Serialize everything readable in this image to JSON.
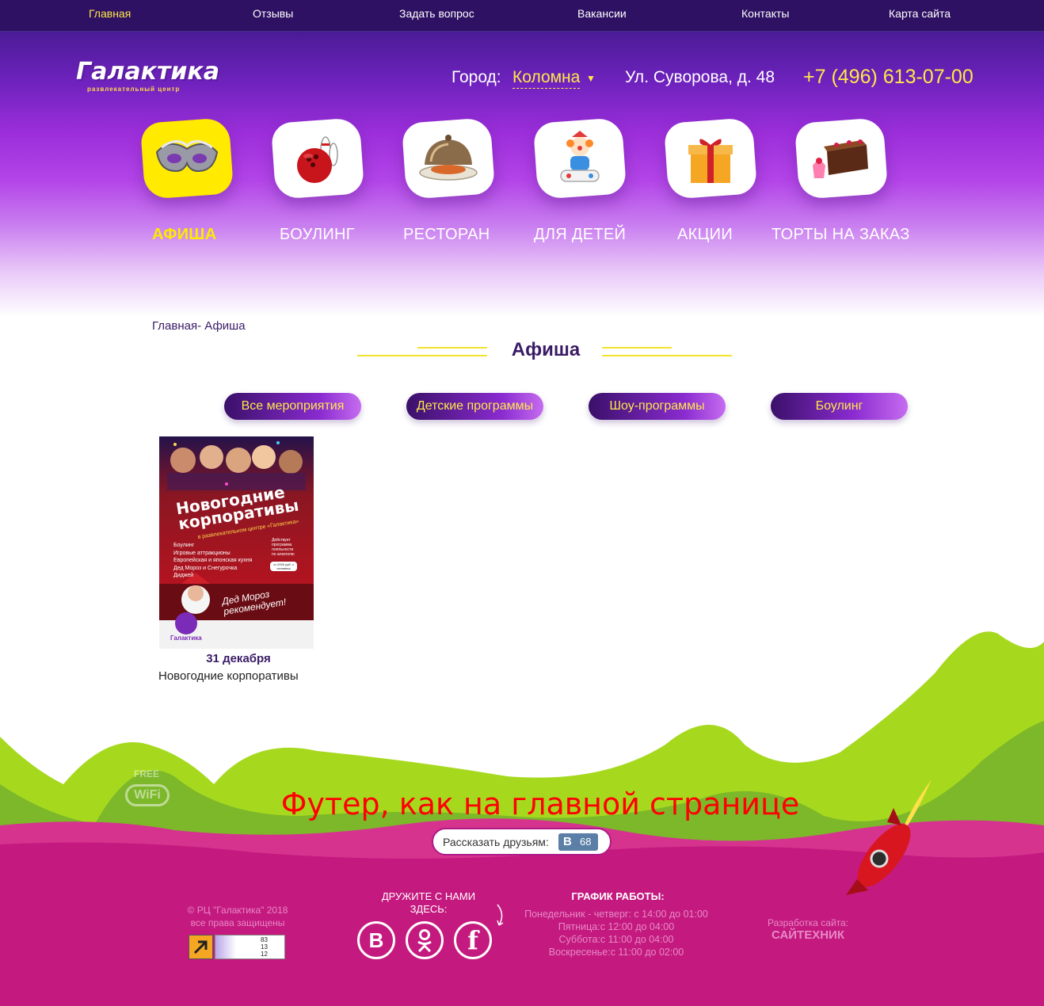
{
  "topnav": {
    "items": [
      "Главная",
      "Отзывы",
      "Задать вопрос",
      "Вакансии",
      "Контакты",
      "Карта сайта"
    ],
    "active_index": 0
  },
  "header": {
    "logo_text": "Галактика",
    "logo_subtitle": "развлекательный центр",
    "city_label": "Город:",
    "city_value": "Коломна",
    "address": "Ул. Суворова, д. 48",
    "phone": "+7 (496) 613-07-00"
  },
  "categories": [
    {
      "label": "АФИША",
      "icon": "carnival-mask-icon",
      "active": true
    },
    {
      "label": "БОУЛИНГ",
      "icon": "bowling-icon",
      "active": false
    },
    {
      "label": "РЕСТОРАН",
      "icon": "restaurant-cloche-icon",
      "active": false
    },
    {
      "label": "ДЛЯ ДЕТЕЙ",
      "icon": "clown-toy-icon",
      "active": false
    },
    {
      "label": "АКЦИИ",
      "icon": "gift-box-icon",
      "active": false
    },
    {
      "label": "ТОРТЫ НА ЗАКАЗ",
      "icon": "cake-icon",
      "active": false
    }
  ],
  "breadcrumb": {
    "home": "Главная",
    "separator": "-",
    "current": "Афиша"
  },
  "page_title": "Афиша",
  "filters": [
    "Все мероприятия",
    "Детские программы",
    "Шоу-программы",
    "Боулинг"
  ],
  "events": [
    {
      "date": "31 декабря",
      "title": "Новогодние корпоративы",
      "poster": {
        "headline_1": "Новогодние",
        "headline_2": "корпоративы",
        "subline": "в развлекательном центре «Галактика»",
        "list": [
          "Боулинг",
          "Игровые аттракционы",
          "Европейская и японская кухня",
          "Дед Мороз и Снегурочка",
          "Диджей"
        ],
        "badge": "Действует программа лояльности по алкоголю",
        "price": "от 2000 руб. с человека",
        "santa_caption_1": "Дед Мороз",
        "santa_caption_2": "рекомендует!",
        "logo": "Галактика"
      }
    }
  ],
  "footer": {
    "placeholder_note": "Футер, как на главной странице",
    "share_label": "Рассказать друзьям:",
    "share_count": "68",
    "share_network": "В",
    "wifi_top": "FREE",
    "wifi_bottom": "WiFi",
    "copyright_line1": "© РЦ \"Галактика\" 2018",
    "copyright_line2": "все права защищены",
    "counter_values": [
      "83",
      "13",
      "12"
    ],
    "friends_title_1": "ДРУЖИТЕ С НАМИ",
    "friends_title_2": "ЗДЕСЬ:",
    "social": [
      "vk-icon",
      "odnoklassniki-icon",
      "facebook-icon"
    ],
    "schedule_title": "ГРАФИК РАБОТЫ:",
    "schedule": [
      "Понедельник - четверг: с 14:00 до 01:00",
      "Пятница:с 12:00 до 04:00",
      "Суббота:с 11:00 до 04:00",
      "Воскресенье:с 11:00 до 02:00"
    ],
    "developer_label": "Разработка сайта:",
    "developer_name": "САЙТЕХНИК"
  },
  "colors": {
    "accent_yellow": "#ffe74a",
    "deep_purple": "#2e1162",
    "footer_magenta": "#c4197f",
    "hill_green": "#a6d91e"
  }
}
